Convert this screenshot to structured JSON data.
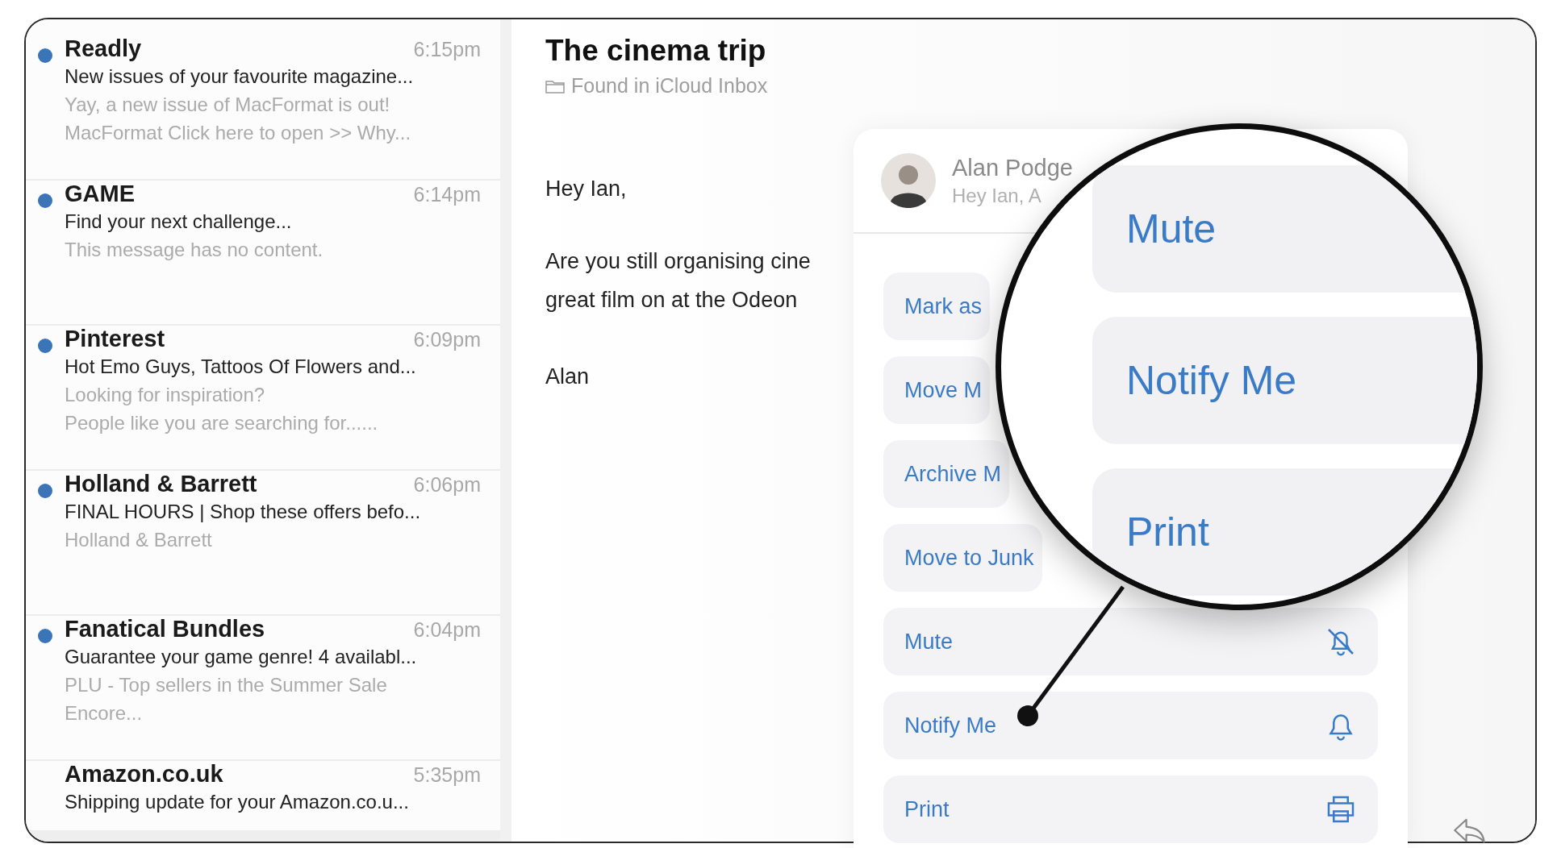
{
  "messages": [
    {
      "sender": "Readly",
      "time": "6:15pm",
      "subject": "New issues of your favourite magazine...",
      "preview": [
        "Yay, a new issue of MacFormat is out!",
        "MacFormat Click here to open >> Why..."
      ],
      "unread": true
    },
    {
      "sender": "GAME",
      "time": "6:14pm",
      "subject": "Find your next challenge...",
      "preview": [
        "This message has no content."
      ],
      "unread": true
    },
    {
      "sender": "Pinterest",
      "time": "6:09pm",
      "subject": "Hot Emo Guys, Tattoos Of Flowers and...",
      "preview": [
        "Looking for inspiration?",
        "People like you are searching for......"
      ],
      "unread": true
    },
    {
      "sender": "Holland & Barrett",
      "time": "6:06pm",
      "subject": "FINAL HOURS | Shop these offers befo...",
      "preview": [
        "Holland & Barrett"
      ],
      "unread": true
    },
    {
      "sender": "Fanatical Bundles",
      "time": "6:04pm",
      "subject": "Guarantee your game genre! 4 availabl...",
      "preview": [
        "PLU - Top sellers in the Summer Sale",
        "Encore..."
      ],
      "unread": true
    },
    {
      "sender": "Amazon.co.uk",
      "time": "5:35pm",
      "subject": "Shipping update for your Amazon.co.u...",
      "unread": false
    }
  ],
  "message": {
    "subject": "The cinema trip",
    "location": "Found in iCloud Inbox",
    "greeting": "Hey Ian,",
    "body_lines": [
      "Are you still organising cine",
      "great film on at the Odeon"
    ],
    "signature": "Alan"
  },
  "context_menu": {
    "sender_name": "Alan Podge",
    "snippet": "Hey Ian, A",
    "items": [
      {
        "label": "Mark as",
        "kind": "action"
      },
      {
        "label": "Move M",
        "kind": "action"
      },
      {
        "label": "Archive M",
        "kind": "action"
      },
      {
        "label": "Move to Junk",
        "kind": "action"
      },
      {
        "label": "Mute",
        "kind": "mute"
      },
      {
        "label": "Notify Me",
        "kind": "notify"
      },
      {
        "label": "Print",
        "kind": "print"
      }
    ]
  },
  "magnifier": {
    "items": [
      "Mute",
      "Notify Me",
      "Print"
    ]
  }
}
